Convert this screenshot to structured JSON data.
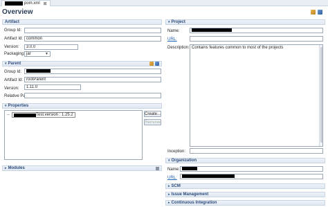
{
  "editor_tab": {
    "label": "pom.xml",
    "close_glyph": "⊠"
  },
  "page_title": "Overview",
  "artifact": {
    "header": "Artifact",
    "group_id_label": "Group Id:",
    "group_id_value": "",
    "artifact_id_label": "Artifact Id:",
    "artifact_id_value": "common",
    "version_label": "Version:",
    "version_value": "3.0.0",
    "packaging_label": "Packaging:",
    "packaging_value": "jar"
  },
  "parent": {
    "header": "Parent",
    "group_id_label": "Group Id:",
    "artifact_id_label": "Artifact Id:",
    "artifact_id_value": "rootParent",
    "version_label": "Version:",
    "version_value": "1.11.0",
    "relative_path_label": "Relative Pa",
    "relative_path_value": ""
  },
  "properties": {
    "header": "Properties",
    "row_text": "Test.version : 1.25.2",
    "create_label": "Create...",
    "remove_label": "Remove"
  },
  "modules": {
    "header": "Modules"
  },
  "project": {
    "header": "Project",
    "name_label": "Name:",
    "url_label": "URL:",
    "description_label": "Description:",
    "description_value": "Contains features common to most of the projects",
    "inception_label": "Inception:",
    "inception_value": ""
  },
  "organization": {
    "header": "Organization",
    "name_label": "Name:",
    "url_label": "URL:"
  },
  "collapsed_sections": [
    "SCM",
    "Issue Management",
    "Continuous Integration"
  ],
  "colors": {
    "section_text": "#2b4a7a",
    "link": "#1a5fb4",
    "title": "#2a3b55"
  }
}
